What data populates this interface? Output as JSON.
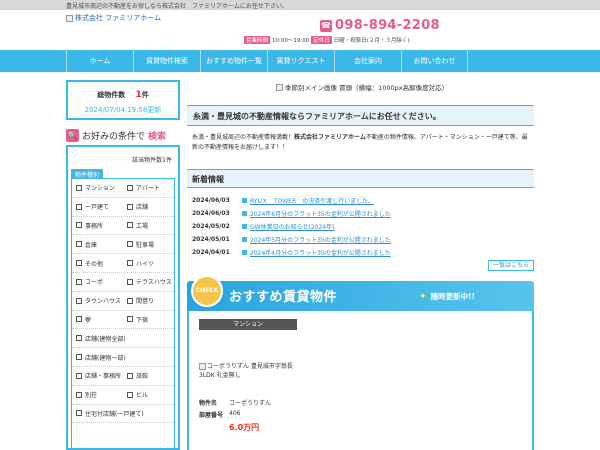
{
  "topbar": {
    "text": "豊見城市周辺の不動産をお探しなら株式会社　ファミリアホームにお任せ下さい。"
  },
  "header": {
    "logo_alt": "株式会社 ファミリアホーム",
    "phone": "098-894-2208",
    "hours_label": "営業時間",
    "hours": "10:00～19:00",
    "closed_label": "定休日",
    "closed": "日曜・祝祭日(２月・３月除く)"
  },
  "nav": {
    "items": [
      "ホーム",
      "賃貸物件検索",
      "おすすめ物件一覧",
      "賃貸リクエスト",
      "会社案内",
      "お問い合わせ"
    ]
  },
  "count": {
    "label": "総物件数",
    "number": "1",
    "unit": "件",
    "updated": "2024/07/04 19:58更新"
  },
  "search": {
    "title_prefix": "お好みの条件で",
    "title_accent": "検索",
    "match_count": "該当物件数1件",
    "type_title": "物件種別",
    "types": [
      [
        "マンション",
        "アパート"
      ],
      [
        "一戸建て",
        "店舗"
      ],
      [
        "事務所",
        "工場"
      ],
      [
        "倉庫",
        "駐車場"
      ],
      [
        "その他",
        "ハイツ"
      ],
      [
        "コーポ",
        "テラスハウス"
      ],
      [
        "タウンハウス",
        "間借り"
      ],
      [
        "寮",
        "下宿"
      ],
      [
        "店舗(建物全部)"
      ],
      [
        "店舗(建物一部)"
      ],
      [
        "店舗・事務所",
        "旅館"
      ],
      [
        "別荘",
        "ビル"
      ],
      [
        "住宅付店舗(一戸建て)"
      ]
    ]
  },
  "hero": {
    "alt": "季節別メイン画像 冒頭（横幅：1000px高解像度対応）"
  },
  "intro": {
    "title": "糸満・豊見城の不動産情報ならファミリアホームにお任せください。",
    "text_before": "糸満・豊見城周辺の不動産情報満載！",
    "text_bold": "株式会社ファミリアホーム",
    "text_after": "不動産の物件情報、アパート・マンション・一戸建て等、最新の不動産情報をお届けします！！"
  },
  "news": {
    "title": "新着情報",
    "items": [
      {
        "date": "2024/06/03",
        "text": "RYUＸ　TOWER　の決済引渡し行いました。"
      },
      {
        "date": "2024/06/03",
        "text": "2024年6月分のフラット35の金利が公開されました"
      },
      {
        "date": "2024/05/02",
        "text": "GW休業日のお知らせ(2024年)"
      },
      {
        "date": "2024/05/01",
        "text": "2024年5月分のフラット35の金利が公開されました"
      },
      {
        "date": "2024/04/01",
        "text": "2024年4月分のフラット35の金利が公開されました"
      }
    ],
    "more": "一覧はこちら"
  },
  "reco": {
    "check": "CHECK",
    "title": "おすすめ賃貸物件",
    "subtitle": "随時更新中!!",
    "card": {
      "type": "マンション",
      "img_alt": "コーポうりずん 豊見城市字翁長 3LDK 礼金無し",
      "name_key": "物件名",
      "name_val": "コーポうりずん",
      "room_key": "部屋番号",
      "room_val": "406",
      "price": "6.0万円"
    }
  }
}
